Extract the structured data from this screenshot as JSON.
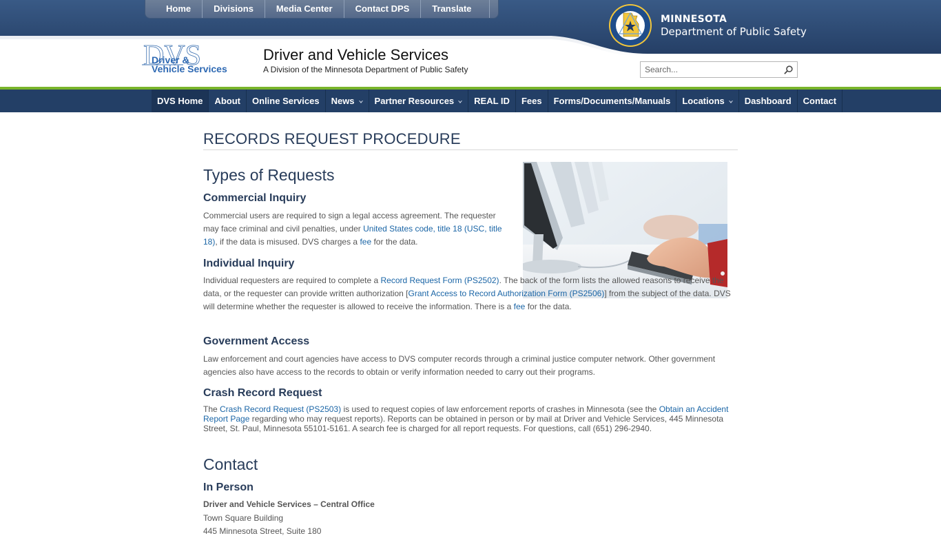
{
  "utility_nav": [
    "Home",
    "Divisions",
    "Media Center",
    "Contact DPS",
    "Translate"
  ],
  "agency": {
    "line1": "MINNESOTA",
    "line2": "Department of Public Safety"
  },
  "site": {
    "logo_line1": "Driver &",
    "logo_line2": "Vehicle Services",
    "logo_letters": "DVS",
    "title": "Driver and Vehicle Services",
    "subtitle": "A Division of the Minnesota Department of Public Safety"
  },
  "search": {
    "placeholder": "Search...",
    "value": ""
  },
  "main_nav": [
    {
      "label": "DVS Home",
      "dropdown": false,
      "active": true
    },
    {
      "label": "About",
      "dropdown": false
    },
    {
      "label": "Online Services",
      "dropdown": false
    },
    {
      "label": "News",
      "dropdown": true
    },
    {
      "label": "Partner Resources",
      "dropdown": true
    },
    {
      "label": "REAL ID",
      "dropdown": false
    },
    {
      "label": "Fees",
      "dropdown": false
    },
    {
      "label": "Forms/Documents/Manuals",
      "dropdown": false
    },
    {
      "label": "Locations",
      "dropdown": true
    },
    {
      "label": "Dashboard",
      "dropdown": false
    },
    {
      "label": "Contact",
      "dropdown": false
    }
  ],
  "colors": {
    "header_blue": "#2b4a74",
    "nav_blue": "#233f66",
    "accent_green": "#79b42b",
    "link_blue": "#1a65a6",
    "heading": "#283c5a"
  },
  "page": {
    "title": "RECORDS REQUEST PROCEDURE",
    "types_heading": "Types of Requests",
    "commercial": {
      "heading": "Commercial Inquiry",
      "t1": "Commercial users are required to sign a legal access agreement. The requester may face criminal and civil penalties, under ",
      "link1": "United States code, title 18 (USC, title 18)",
      "t2": ", if the data is misused. DVS charges a ",
      "link2": "fee",
      "t3": " for the data."
    },
    "individual": {
      "heading": "Individual Inquiry",
      "t1": "Individual requesters are required to complete a ",
      "link1": "Record Request Form (PS2502)",
      "t2": ". The back of the form lists the allowed reasons to receive the data, or the requester can provide written authorization [",
      "link2": "Grant Access to Record Authorization Form (PS2506)",
      "t3": "] from the subject of the data. DVS will determine whether the requester is allowed to receive the information. There is a ",
      "link3": "fee",
      "t4": " for the data."
    },
    "government": {
      "heading": "Government Access",
      "text": "Law enforcement and court agencies have access to DVS computer records through a criminal justice computer network. Other government agencies also have access to the records to obtain or verify information needed to carry out their programs."
    },
    "crash": {
      "heading": "Crash Record Request",
      "t1": "The ",
      "link1": "Crash Record Request (PS2503)",
      "t2": " is used to request copies of law enforcement reports of crashes in Minnesota (see the ",
      "link2": "Obtain an Accident Report Page",
      "t3": " regarding who may request reports). Reports can be obtained in person or by mail at Driver and Vehicle Services, 445 Minnesota Street, St. Paul, Minnesota 55101-5161. A search fee is charged for all report requests. For questions, call (651) 296-2940."
    },
    "contact_heading": "Contact",
    "in_person": {
      "heading": "In Person",
      "office": "Driver and Vehicle Services – Central Office",
      "building": "Town Square Building",
      "address_partial": "445 Minnesota Street, Suite 180"
    },
    "image_alt": "Hands typing on a computer keyboard"
  }
}
